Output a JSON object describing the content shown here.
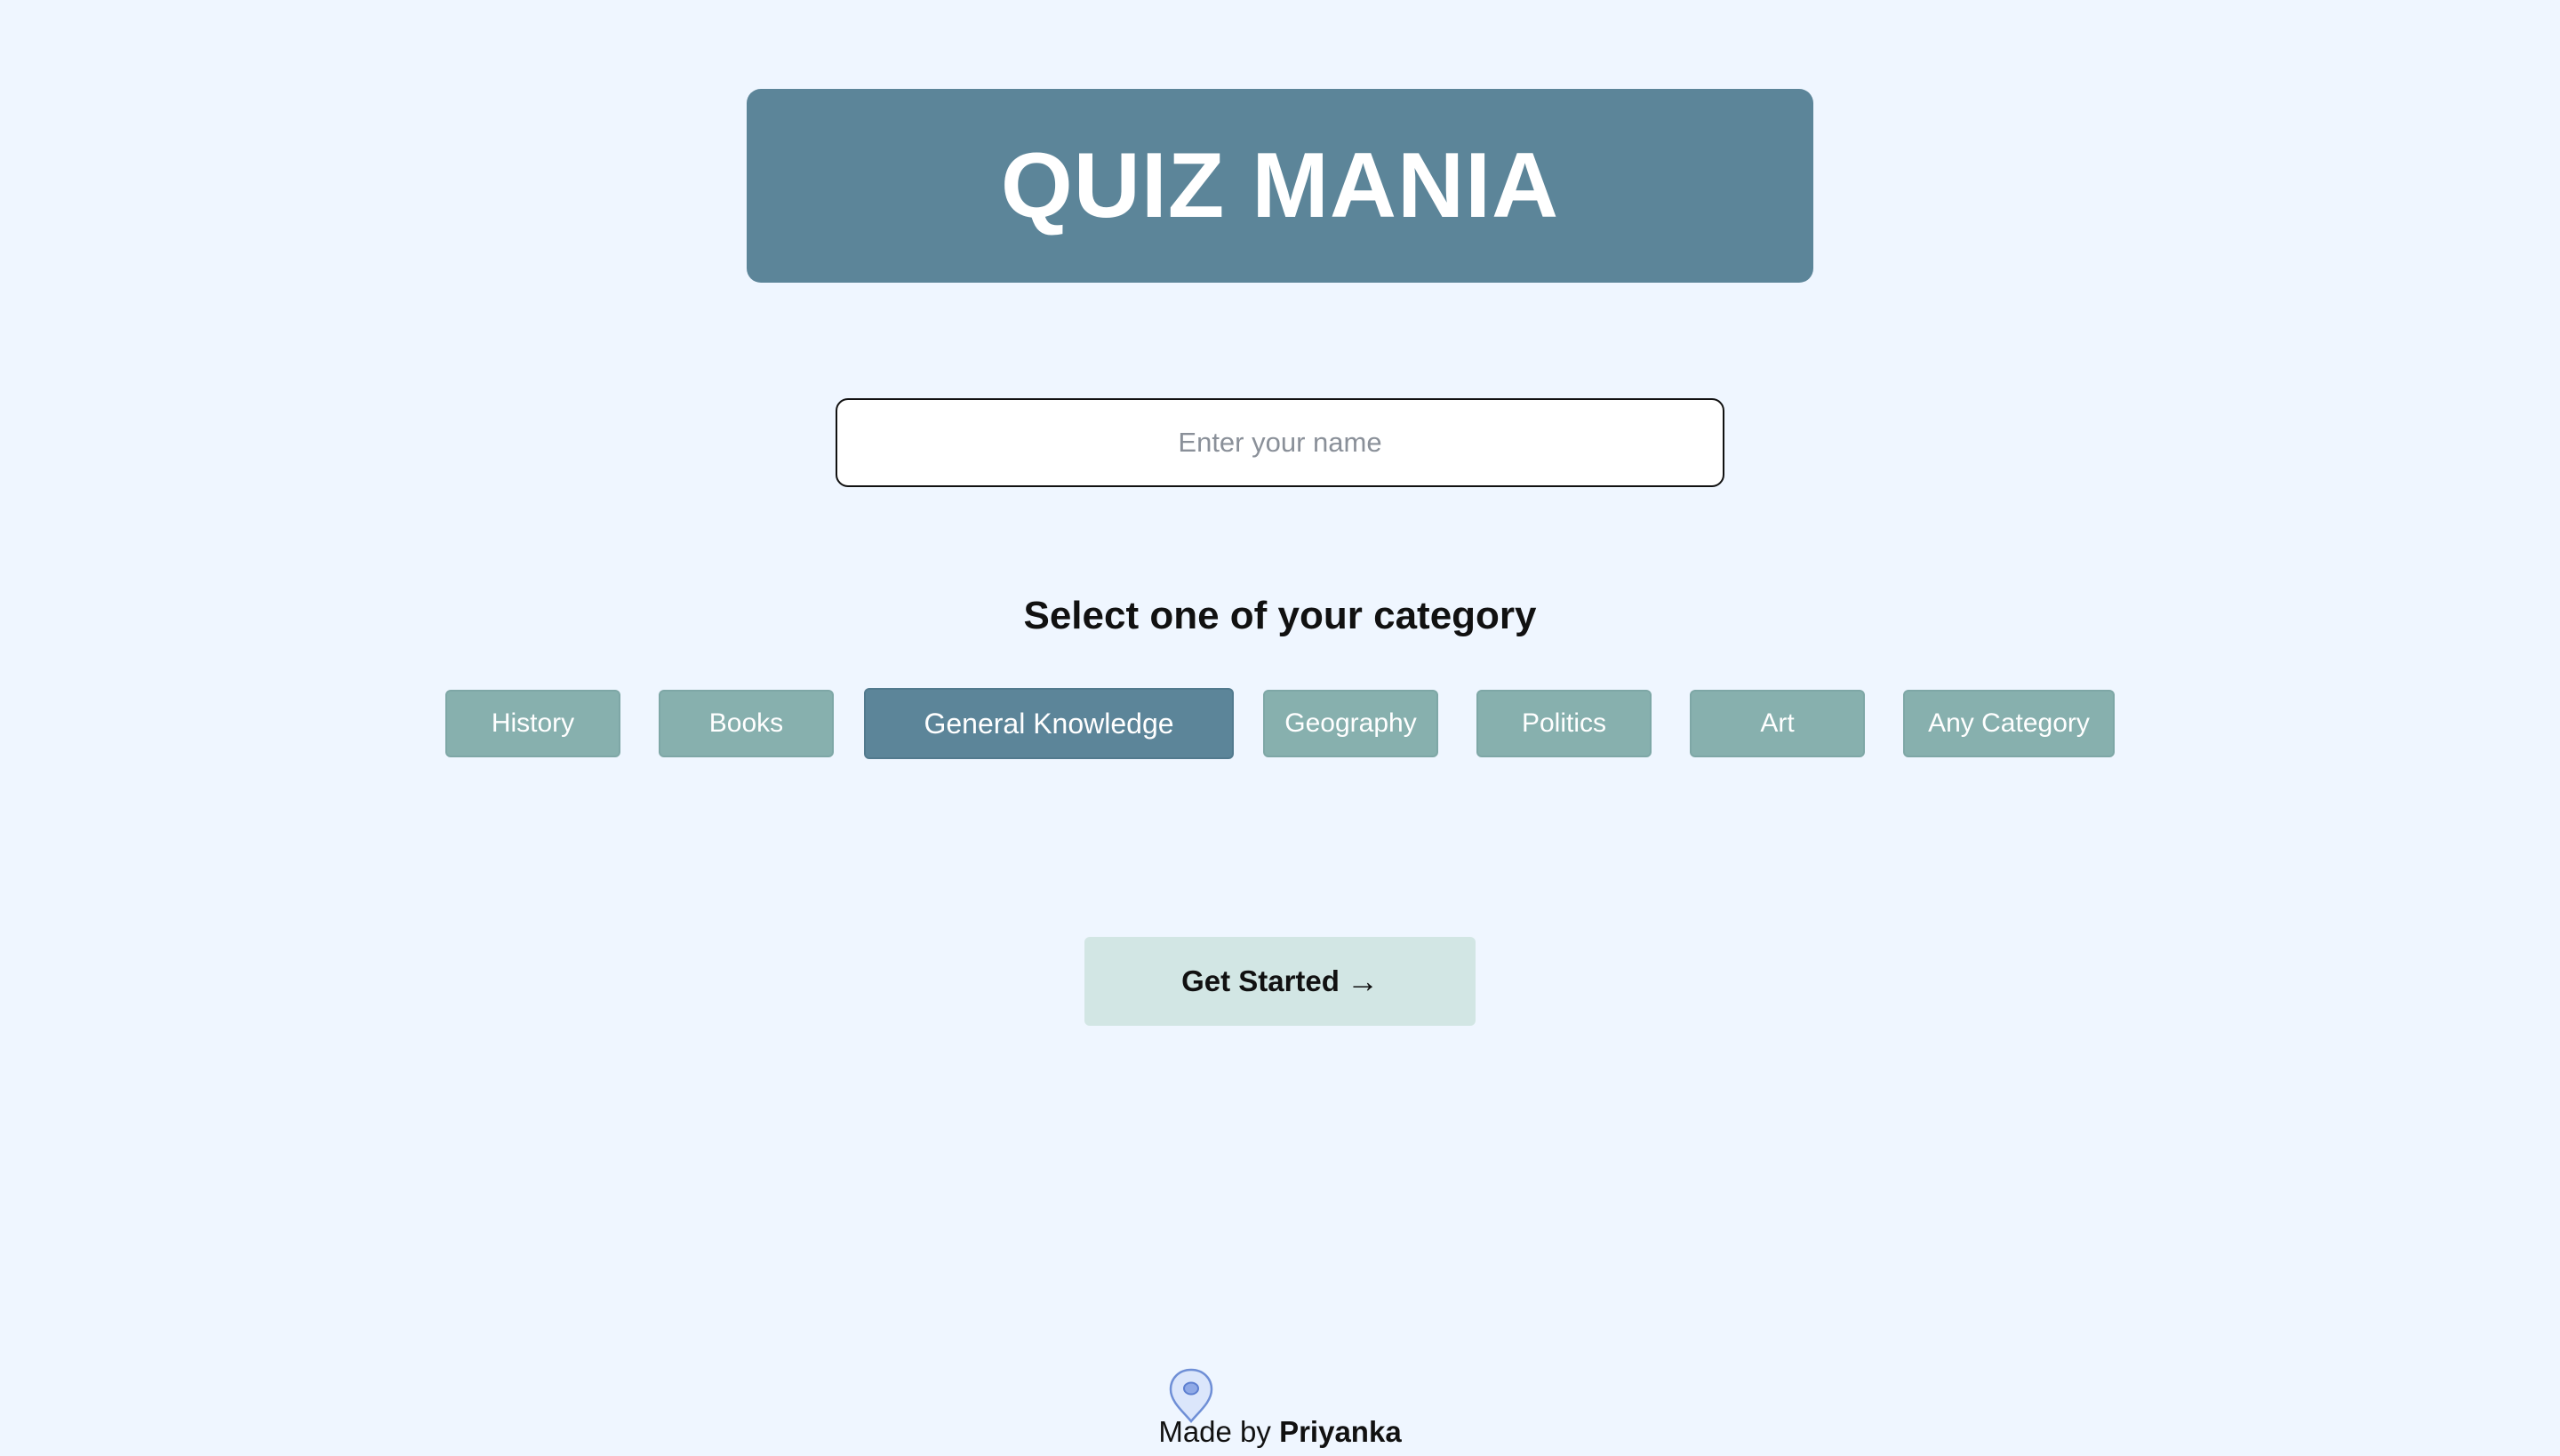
{
  "header": {
    "title": "QUIZ MANIA"
  },
  "name_input": {
    "placeholder": "Enter your name",
    "value": ""
  },
  "category_section": {
    "heading": "Select one of your category",
    "categories": [
      {
        "label": "History",
        "selected": false
      },
      {
        "label": "Books",
        "selected": false
      },
      {
        "label": "General Knowledge",
        "selected": true
      },
      {
        "label": "Geography",
        "selected": false
      },
      {
        "label": "Politics",
        "selected": false
      },
      {
        "label": "Art",
        "selected": false
      },
      {
        "label": "Any Category",
        "selected": false
      }
    ]
  },
  "start_button": {
    "label": "Get Started",
    "icon": "arrow-right-icon"
  },
  "footer": {
    "prefix": "Made by",
    "author": "Priyanka",
    "icon": "location-pin-icon"
  },
  "colors": {
    "background": "#eff6ff",
    "banner": "#5c8599",
    "category_button": "#87b0ae",
    "category_button_selected": "#5c8599",
    "start_button": "#d2e6e4"
  }
}
